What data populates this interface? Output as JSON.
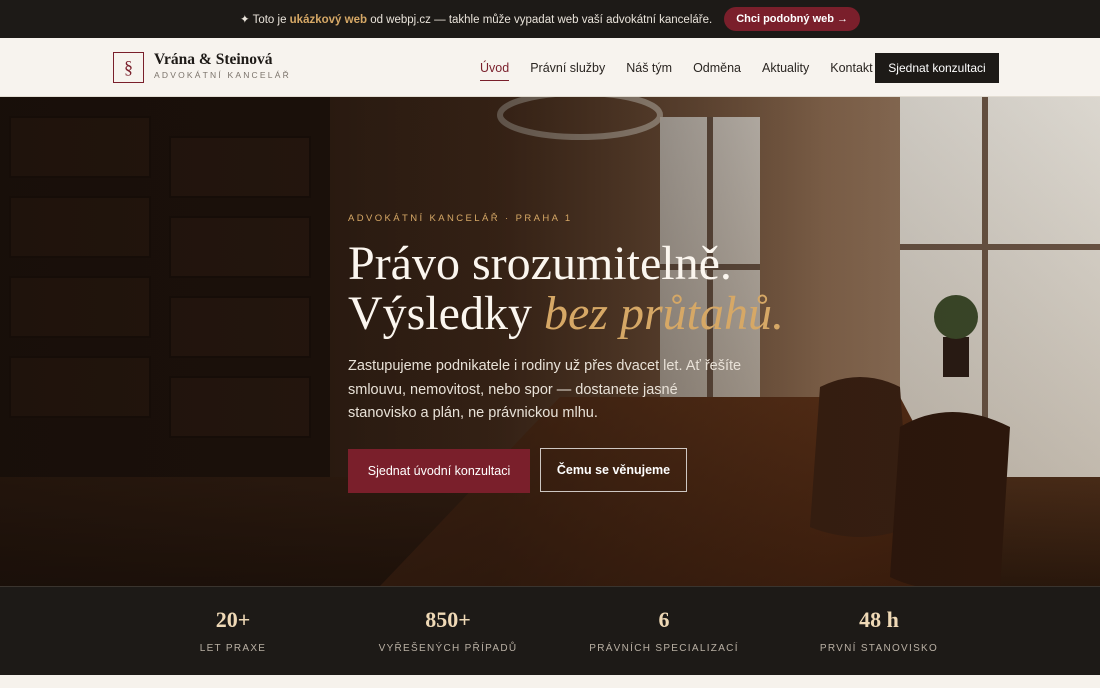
{
  "topbar": {
    "prefix": "✦ Toto je ",
    "highlight": "ukázkový web",
    "suffix": " od webpj.cz — takhle může vypadat web vaší advokátní kanceláře.",
    "cta": "Chci podobný web →"
  },
  "brand": {
    "mark": "§",
    "name": "Vrána & Steinová",
    "subtitle": "ADVOKÁTNÍ KANCELÁŘ"
  },
  "nav": {
    "items": [
      {
        "label": "Úvod",
        "active": true
      },
      {
        "label": "Právní služby",
        "active": false
      },
      {
        "label": "Náš tým",
        "active": false
      },
      {
        "label": "Odměna",
        "active": false
      },
      {
        "label": "Aktuality",
        "active": false
      },
      {
        "label": "Kontakt",
        "active": false
      }
    ],
    "cta": "Sjednat konzultaci"
  },
  "hero": {
    "eyebrow": "ADVOKÁTNÍ KANCELÁŘ · PRAHA 1",
    "title_line1": "Právo srozumitelně.",
    "title_line2_plain": "Výsledky ",
    "title_line2_emph": "bez průtahů.",
    "lead": "Zastupujeme podnikatele i rodiny už přes dvacet let. Ať řešíte smlouvu, nemovitost, nebo spor — dostanete jasné stanovisko a plán, ne právnickou mlhu.",
    "primary_button": "Sjednat úvodní konzultaci",
    "secondary_button": "Čemu se věnujeme"
  },
  "stats": [
    {
      "value": "20+",
      "label": "LET PRAXE"
    },
    {
      "value": "850+",
      "label": "VYŘEŠENÝCH PŘÍPADŮ"
    },
    {
      "value": "6",
      "label": "PRÁVNÍCH SPECIALIZACÍ"
    },
    {
      "value": "48 h",
      "label": "PRVNÍ STANOVISKO"
    }
  ],
  "colors": {
    "accent": "#7a1f2b",
    "gold": "#d6a866",
    "dark": "#1d1a17",
    "header_bg": "#f7f3ee"
  }
}
